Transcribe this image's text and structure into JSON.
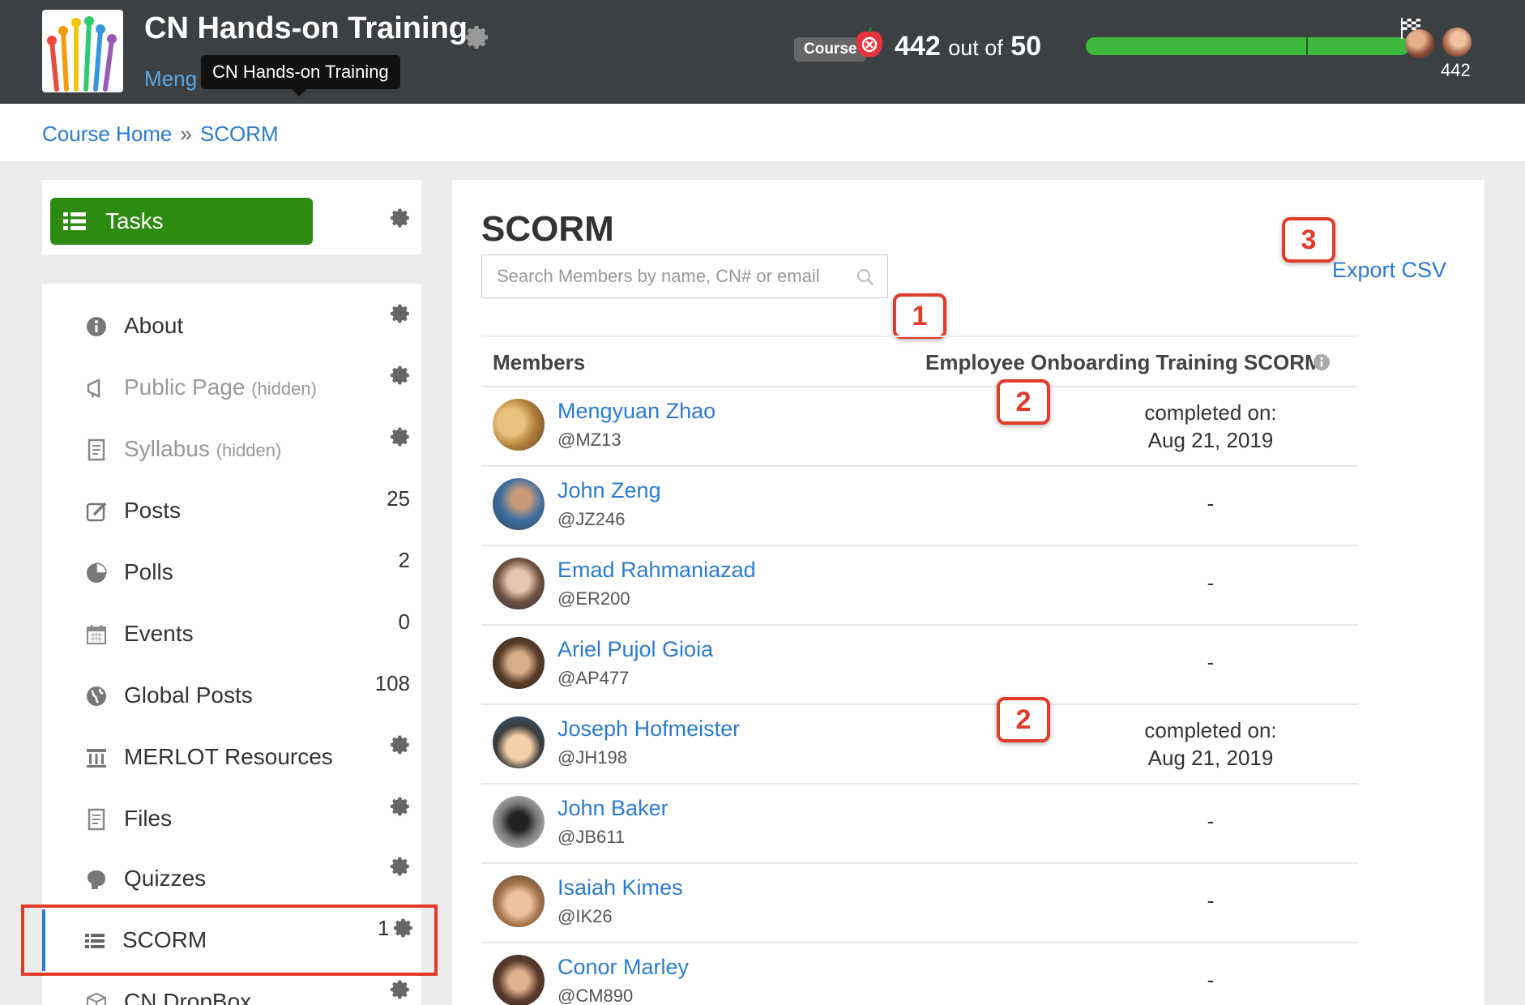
{
  "header": {
    "course_title": "CN Hands-on Training",
    "user_name_visible": "Meng",
    "tooltip": "CN Hands-on Training",
    "badge": "Course",
    "points": "442",
    "points_out_of_text": "out of",
    "points_max": "50",
    "progress_fraction": 1.0,
    "avatar_count": "442"
  },
  "breadcrumb": {
    "home": "Course Home",
    "current": "SCORM"
  },
  "sidebar": {
    "tasks_label": "Tasks",
    "items": [
      {
        "label": "About",
        "icon": "info-icon",
        "count": ""
      },
      {
        "label": "Public Page",
        "suffix": "(hidden)",
        "icon": "megaphone-icon",
        "count": ""
      },
      {
        "label": "Syllabus",
        "suffix": "(hidden)",
        "icon": "document-icon",
        "count": ""
      },
      {
        "label": "Posts",
        "icon": "edit-icon",
        "count": "25"
      },
      {
        "label": "Polls",
        "icon": "pie-chart-icon",
        "count": "2"
      },
      {
        "label": "Events",
        "icon": "calendar-icon",
        "count": "0"
      },
      {
        "label": "Global Posts",
        "icon": "globe-icon",
        "count": "108"
      },
      {
        "label": "MERLOT Resources",
        "icon": "columns-icon",
        "count": ""
      },
      {
        "label": "Files",
        "icon": "file-icon",
        "count": ""
      },
      {
        "label": "Quizzes",
        "icon": "brain-icon",
        "count": ""
      },
      {
        "label": "SCORM",
        "icon": "list-icon",
        "count": "1"
      },
      {
        "label": "CN DropBox",
        "icon": "box-icon",
        "count": ""
      }
    ]
  },
  "main": {
    "title": "SCORM",
    "search_placeholder": "Search Members by name, CN# or email",
    "export_label": "Export CSV",
    "markers": [
      "1",
      "2",
      "2",
      "3"
    ],
    "columns": {
      "members": "Members",
      "scorm": "Employee Onboarding Training SCORM"
    },
    "rows": [
      {
        "name": "Mengyuan Zhao",
        "handle": "@MZ13",
        "status": "completed on:",
        "date": "Aug 21, 2019"
      },
      {
        "name": "John Zeng",
        "handle": "@JZ246",
        "status": "-",
        "date": ""
      },
      {
        "name": "Emad Rahmaniazad",
        "handle": "@ER200",
        "status": "-",
        "date": ""
      },
      {
        "name": "Ariel Pujol Gioia",
        "handle": "@AP477",
        "status": "-",
        "date": ""
      },
      {
        "name": "Joseph Hofmeister",
        "handle": "@JH198",
        "status": "completed on:",
        "date": "Aug 21, 2019"
      },
      {
        "name": "John Baker",
        "handle": "@JB611",
        "status": "-",
        "date": ""
      },
      {
        "name": "Isaiah Kimes",
        "handle": "@IK26",
        "status": "-",
        "date": ""
      },
      {
        "name": "Conor Marley",
        "handle": "@CM890",
        "status": "-",
        "date": ""
      }
    ]
  },
  "colors": {
    "header_bg": "#3c4043",
    "link": "#2b7bd0",
    "tasks_green": "#2e8b12",
    "progress_green": "#3dba3d",
    "annotation_red": "#e23b2a"
  }
}
